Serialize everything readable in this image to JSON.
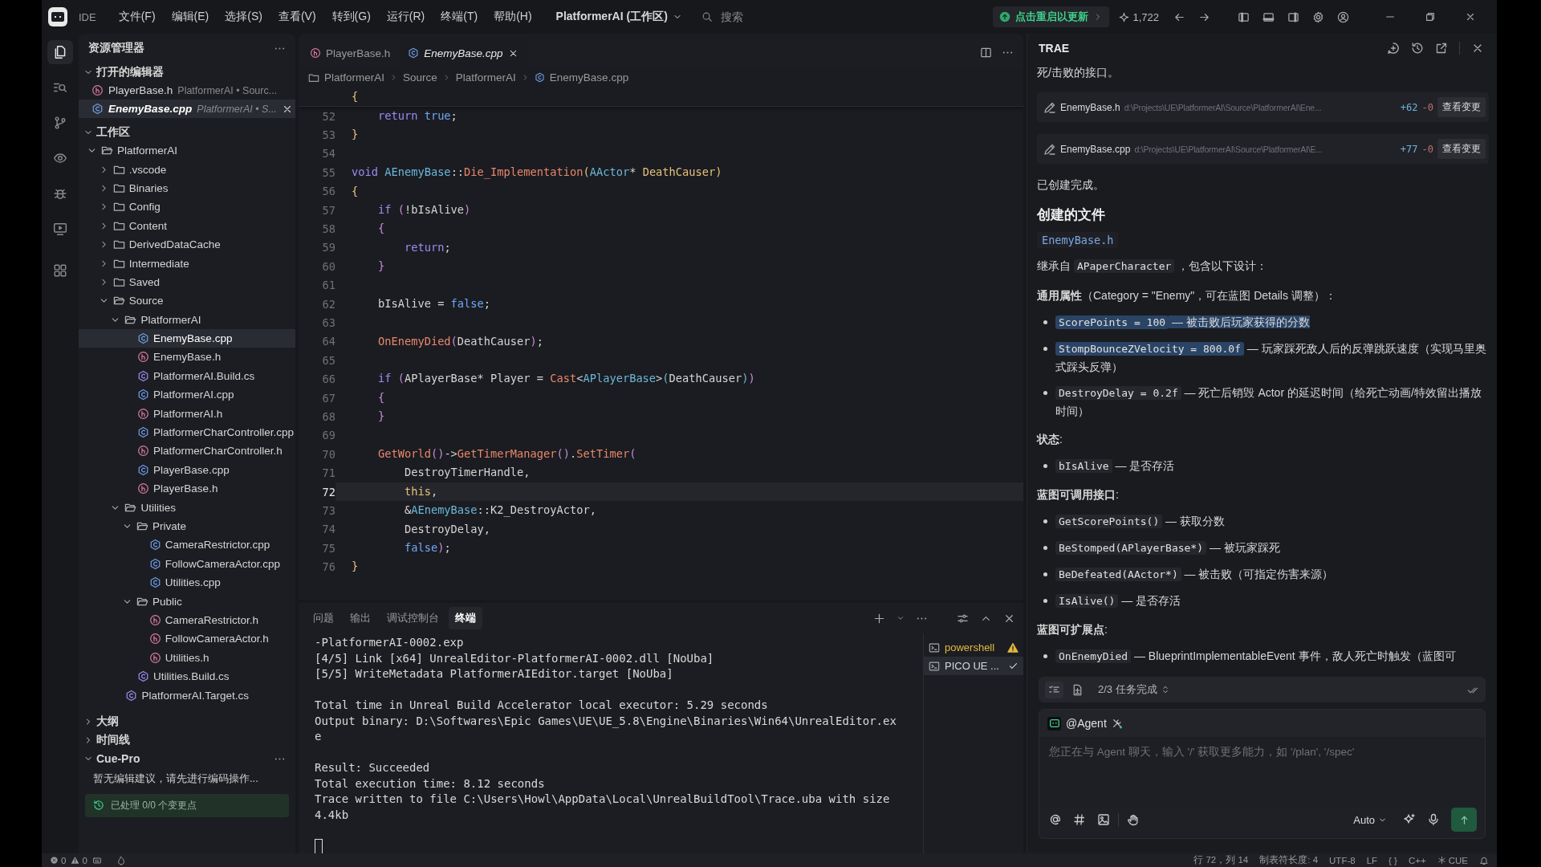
{
  "title_bar": {
    "app_label": "IDE",
    "menus": [
      "文件(F)",
      "编辑(E)",
      "选择(S)",
      "查看(V)",
      "转到(G)",
      "运行(R)",
      "终端(T)",
      "帮助(H)"
    ],
    "workspace": "PlatformerAI (工作区)",
    "search": {
      "placeholder": "搜索"
    },
    "update_button": "点击重启以更新",
    "count": "1,722"
  },
  "activity_bar": {
    "items": [
      {
        "kind": "files",
        "selected": true
      },
      {
        "kind": "search",
        "selected": false
      },
      {
        "kind": "source_control",
        "selected": false
      },
      {
        "kind": "preview",
        "selected": false
      },
      {
        "kind": "debug",
        "selected": false
      },
      {
        "kind": "remote",
        "selected": false
      },
      {
        "kind": "extensions",
        "selected": false
      }
    ]
  },
  "sidebar": {
    "title": "资源管理器",
    "open_editors": {
      "title": "打开的编辑器",
      "expanded": true,
      "items": [
        {
          "name": "PlayerBase.h",
          "kind": "h",
          "description": "PlatformerAI • Sourc...",
          "selected": false
        },
        {
          "name": "EnemyBase.cpp",
          "kind": "cpp",
          "description": "PlatformerAI • S...",
          "selected": true
        }
      ]
    },
    "workspace": {
      "title": "工作区",
      "expanded": true,
      "tree": [
        {
          "name": "PlatformerAI",
          "kind": "folder",
          "expanded": true,
          "selected": false,
          "children": [
            {
              "name": ".vscode",
              "kind": "folder",
              "expanded": false,
              "selected": false
            },
            {
              "name": "Binaries",
              "kind": "folder",
              "expanded": false,
              "selected": false
            },
            {
              "name": "Config",
              "kind": "folder",
              "expanded": false,
              "selected": false
            },
            {
              "name": "Content",
              "kind": "folder",
              "expanded": false,
              "selected": false
            },
            {
              "name": "DerivedDataCache",
              "kind": "folder",
              "expanded": false,
              "selected": false
            },
            {
              "name": "Intermediate",
              "kind": "folder",
              "expanded": false,
              "selected": false
            },
            {
              "name": "Saved",
              "kind": "folder",
              "expanded": false,
              "selected": false
            },
            {
              "name": "Source",
              "kind": "folder",
              "expanded": true,
              "selected": false,
              "children": [
                {
                  "name": "PlatformerAI",
                  "kind": "folder",
                  "expanded": true,
                  "selected": false,
                  "children": [
                    {
                      "name": "EnemyBase.cpp",
                      "kind": "cpp",
                      "selected": true
                    },
                    {
                      "name": "EnemyBase.h",
                      "kind": "h",
                      "selected": false
                    },
                    {
                      "name": "PlatformerAI.Build.cs",
                      "kind": "cs",
                      "selected": false
                    },
                    {
                      "name": "PlatformerAI.cpp",
                      "kind": "cpp",
                      "selected": false
                    },
                    {
                      "name": "PlatformerAI.h",
                      "kind": "h",
                      "selected": false
                    },
                    {
                      "name": "PlatformerCharController.cpp",
                      "kind": "cpp",
                      "selected": false
                    },
                    {
                      "name": "PlatformerCharController.h",
                      "kind": "h",
                      "selected": false
                    },
                    {
                      "name": "PlayerBase.cpp",
                      "kind": "cpp",
                      "selected": false
                    },
                    {
                      "name": "PlayerBase.h",
                      "kind": "h",
                      "selected": false
                    }
                  ]
                },
                {
                  "name": "Utilities",
                  "kind": "folder",
                  "expanded": true,
                  "selected": false,
                  "children": [
                    {
                      "name": "Private",
                      "kind": "folder",
                      "expanded": true,
                      "selected": false,
                      "children": [
                        {
                          "name": "CameraRestrictor.cpp",
                          "kind": "cpp",
                          "selected": false
                        },
                        {
                          "name": "FollowCameraActor.cpp",
                          "kind": "cpp",
                          "selected": false
                        },
                        {
                          "name": "Utilities.cpp",
                          "kind": "cpp",
                          "selected": false
                        }
                      ]
                    },
                    {
                      "name": "Public",
                      "kind": "folder",
                      "expanded": true,
                      "selected": false,
                      "children": [
                        {
                          "name": "CameraRestrictor.h",
                          "kind": "h",
                          "selected": false
                        },
                        {
                          "name": "FollowCameraActor.h",
                          "kind": "h",
                          "selected": false
                        },
                        {
                          "name": "Utilities.h",
                          "kind": "h",
                          "selected": false
                        }
                      ]
                    },
                    {
                      "name": "Utilities.Build.cs",
                      "kind": "cs",
                      "selected": false
                    }
                  ]
                },
                {
                  "name": "PlatformerAI.Target.cs",
                  "kind": "cs",
                  "selected": false
                }
              ]
            }
          ]
        }
      ]
    },
    "sections": [
      {
        "title": "大纲",
        "expanded": false
      },
      {
        "title": "时间线",
        "expanded": false
      }
    ],
    "cue_pro": {
      "title": "Cue-Pro",
      "expanded": true,
      "message": "暂无编辑建议，请先进行编码操作...",
      "status": "已处理 0/0 个变更点"
    }
  },
  "editor": {
    "tabs": [
      {
        "name": "PlayerBase.h",
        "kind": "h",
        "selected": false
      },
      {
        "name": "EnemyBase.cpp",
        "kind": "cpp",
        "selected": true
      }
    ],
    "breadcrumbs": [
      "PlatformerAI",
      "Source",
      "PlatformerAI",
      "EnemyBase.cpp"
    ],
    "sticky_line": [
      {
        "kind": "brace",
        "text": "{"
      }
    ],
    "lines": [
      {
        "number": "52",
        "current": false,
        "tokens": [
          {
            "kind": "keyword",
            "text": "    return"
          },
          {
            "kind": "literal",
            "text": " true"
          },
          {
            "kind": "plain",
            "text": ";"
          }
        ]
      },
      {
        "number": "53",
        "current": false,
        "tokens": [
          {
            "kind": "brace",
            "text": "}"
          }
        ]
      },
      {
        "number": "54",
        "current": false
      },
      {
        "number": "55",
        "current": false,
        "tokens": [
          {
            "kind": "keyword",
            "text": "void"
          },
          {
            "kind": "type",
            "text": " AEnemyBase"
          },
          {
            "kind": "plain",
            "text": "::"
          },
          {
            "kind": "function",
            "text": "Die_Implementation"
          },
          {
            "kind": "brace",
            "text": "("
          },
          {
            "kind": "type",
            "text": "AActor"
          },
          {
            "kind": "plain",
            "text": "* "
          },
          {
            "kind": "param",
            "text": "DeathCauser"
          },
          {
            "kind": "brace",
            "text": ")"
          }
        ]
      },
      {
        "number": "56",
        "current": false,
        "tokens": [
          {
            "kind": "brace",
            "text": "{"
          }
        ]
      },
      {
        "number": "57",
        "current": false,
        "tokens": [
          {
            "kind": "keyword",
            "text": "    if"
          },
          {
            "kind": "paren",
            "text": " ("
          },
          {
            "kind": "plain",
            "text": "!bIsAlive"
          },
          {
            "kind": "paren",
            "text": ")"
          }
        ]
      },
      {
        "number": "58",
        "current": false,
        "tokens": [
          {
            "kind": "paren",
            "text": "    {"
          }
        ]
      },
      {
        "number": "59",
        "current": false,
        "tokens": [
          {
            "kind": "keyword",
            "text": "        return"
          },
          {
            "kind": "plain",
            "text": ";"
          }
        ]
      },
      {
        "number": "60",
        "current": false,
        "tokens": [
          {
            "kind": "paren",
            "text": "    }"
          }
        ]
      },
      {
        "number": "61",
        "current": false
      },
      {
        "number": "62",
        "current": false,
        "tokens": [
          {
            "kind": "plain",
            "text": "    bIsAlive = "
          },
          {
            "kind": "literal",
            "text": "false"
          },
          {
            "kind": "plain",
            "text": ";"
          }
        ]
      },
      {
        "number": "63",
        "current": false
      },
      {
        "number": "64",
        "current": false,
        "tokens": [
          {
            "kind": "function",
            "text": "    OnEnemyDied"
          },
          {
            "kind": "paren",
            "text": "("
          },
          {
            "kind": "plain",
            "text": "DeathCauser"
          },
          {
            "kind": "paren",
            "text": ")"
          },
          {
            "kind": "plain",
            "text": ";"
          }
        ]
      },
      {
        "number": "65",
        "current": false
      },
      {
        "number": "66",
        "current": false,
        "tokens": [
          {
            "kind": "keyword",
            "text": "    if"
          },
          {
            "kind": "paren",
            "text": " ("
          },
          {
            "kind": "plain",
            "text": "APlayerBase* Player = "
          },
          {
            "kind": "function",
            "text": "Cast"
          },
          {
            "kind": "plain",
            "text": "<"
          },
          {
            "kind": "type",
            "text": "APlayerBase"
          },
          {
            "kind": "plain",
            "text": ">"
          },
          {
            "kind": "type",
            "text": "("
          },
          {
            "kind": "plain",
            "text": "DeathCauser"
          },
          {
            "kind": "type",
            "text": ")"
          },
          {
            "kind": "paren",
            "text": ")"
          }
        ]
      },
      {
        "number": "67",
        "current": false,
        "tokens": [
          {
            "kind": "paren",
            "text": "    {"
          }
        ]
      },
      {
        "number": "68",
        "current": false,
        "tokens": [
          {
            "kind": "paren",
            "text": "    }"
          }
        ]
      },
      {
        "number": "69",
        "current": false
      },
      {
        "number": "70",
        "current": false,
        "tokens": [
          {
            "kind": "function",
            "text": "    GetWorld"
          },
          {
            "kind": "paren",
            "text": "()"
          },
          {
            "kind": "plain",
            "text": "->"
          },
          {
            "kind": "function",
            "text": "GetTimerManager"
          },
          {
            "kind": "paren",
            "text": "()"
          },
          {
            "kind": "plain",
            "text": "."
          },
          {
            "kind": "function",
            "text": "SetTimer"
          },
          {
            "kind": "paren",
            "text": "("
          }
        ]
      },
      {
        "number": "71",
        "current": false,
        "tokens": [
          {
            "kind": "plain",
            "text": "        DestroyTimerHandle,"
          }
        ]
      },
      {
        "number": "72",
        "current": true,
        "tokens": [
          {
            "kind": "this",
            "text": "        this"
          },
          {
            "kind": "plain",
            "text": ","
          }
        ]
      },
      {
        "number": "73",
        "current": false,
        "tokens": [
          {
            "kind": "plain",
            "text": "        &"
          },
          {
            "kind": "type",
            "text": "AEnemyBase"
          },
          {
            "kind": "plain",
            "text": "::K2_DestroyActor,"
          }
        ]
      },
      {
        "number": "74",
        "current": false,
        "tokens": [
          {
            "kind": "plain",
            "text": "        DestroyDelay,"
          }
        ]
      },
      {
        "number": "75",
        "current": false,
        "tokens": [
          {
            "kind": "literal",
            "text": "        false"
          },
          {
            "kind": "paren",
            "text": ")"
          },
          {
            "kind": "plain",
            "text": ";"
          }
        ]
      },
      {
        "number": "76",
        "current": false,
        "tokens": [
          {
            "kind": "brace",
            "text": "}"
          }
        ]
      }
    ]
  },
  "panel": {
    "tabs": [
      {
        "label": "问题",
        "selected": false
      },
      {
        "label": "输出",
        "selected": false
      },
      {
        "label": "调试控制台",
        "selected": false
      },
      {
        "label": "终端",
        "selected": true
      }
    ],
    "terminal": {
      "blocks": [
        [
          "-PlatformerAI-0002.exp",
          "[4/5] Link [x64] UnrealEditor-PlatformerAI-0002.dll [NoUba]",
          "[5/5] WriteMetadata PlatformerAIEditor.target [NoUba]"
        ],
        [
          "Total time in Unreal Build Accelerator local executor: 5.29 seconds",
          "Output binary: D:\\Softwares\\Epic Games\\UE\\UE_5.8\\Engine\\Binaries\\Win64\\UnrealEditor.ex",
          "e"
        ],
        [
          "Result: Succeeded",
          "Total execution time: 8.12 seconds",
          "Trace written to file C:\\Users\\Howl\\AppData\\Local\\UnrealBuildTool\\Trace.uba with size",
          "4.4kb"
        ]
      ]
    },
    "sessions": [
      {
        "name": "powershell",
        "kind": "warning",
        "selected": false
      },
      {
        "name": "PICO UE ...",
        "kind": "done",
        "selected": true
      }
    ]
  },
  "chat": {
    "title": "TRAE",
    "blocks": [
      {
        "kind": "text",
        "text": "死/击败的接口。"
      },
      {
        "kind": "file_change",
        "name": "EnemyBase.h",
        "path": "d:\\Projects\\UE\\PlatformerAI\\Source\\PlatformerAI\\Ene...",
        "added": "+62",
        "removed": "-0",
        "action": "查看变更"
      },
      {
        "kind": "file_change",
        "name": "EnemyBase.cpp",
        "path": "d:\\Projects\\UE\\PlatformerAI\\Source\\PlatformerAI\\E...",
        "added": "+77",
        "removed": "-0",
        "action": "查看变更"
      },
      {
        "kind": "text",
        "text": "已创建完成。"
      },
      {
        "kind": "heading",
        "text": "创建的文件"
      },
      {
        "kind": "code",
        "text": "EnemyBase.h"
      },
      {
        "kind": "paragraph",
        "segments": [
          {
            "kind": "text",
            "text": "继承自 ",
            "highlighted": false
          },
          {
            "kind": "code",
            "text": "APaperCharacter",
            "highlighted": false
          },
          {
            "kind": "text",
            "text": " ，包含以下设计：",
            "highlighted": false
          }
        ]
      },
      {
        "kind": "rich",
        "text": "**通用属性**（Category = \"Enemy\"，可在蓝图 Details 调整）："
      },
      {
        "kind": "bullet",
        "segments": [
          {
            "kind": "code",
            "text": "ScorePoints = 100",
            "highlighted": true
          },
          {
            "kind": "text",
            "text": " — 被击败后玩家获得的分数",
            "highlighted": true
          }
        ]
      },
      {
        "kind": "bullet",
        "segments": [
          {
            "kind": "code",
            "text": "StompBounceZVelocity = 800.0f",
            "highlighted": true
          },
          {
            "kind": "text",
            "text": " — 玩家踩死敌人后的反弹跳跃速度（实现马里奥式踩头反弹）",
            "highlighted": false
          }
        ]
      },
      {
        "kind": "bullet",
        "segments": [
          {
            "kind": "code",
            "text": "DestroyDelay = 0.2f",
            "highlighted": false
          },
          {
            "kind": "text",
            "text": " — 死亡后销毁 Actor 的延迟时间（给死亡动画/特效留出播放时间）",
            "highlighted": false
          }
        ]
      },
      {
        "kind": "rich",
        "text": "**状态**:"
      },
      {
        "kind": "bullet",
        "segments": [
          {
            "kind": "code",
            "text": "bIsAlive",
            "highlighted": false
          },
          {
            "kind": "text",
            "text": " — 是否存活",
            "highlighted": false
          }
        ]
      },
      {
        "kind": "rich",
        "text": "**蓝图可调用接口**:"
      },
      {
        "kind": "bullet",
        "segments": [
          {
            "kind": "code",
            "text": "GetScorePoints()",
            "highlighted": false
          },
          {
            "kind": "text",
            "text": " — 获取分数",
            "highlighted": false
          }
        ]
      },
      {
        "kind": "bullet",
        "segments": [
          {
            "kind": "code",
            "text": "BeStomped(APlayerBase*)",
            "highlighted": false
          },
          {
            "kind": "text",
            "text": " — 被玩家踩死",
            "highlighted": false
          }
        ]
      },
      {
        "kind": "bullet",
        "segments": [
          {
            "kind": "code",
            "text": "BeDefeated(AActor*)",
            "highlighted": false
          },
          {
            "kind": "text",
            "text": " — 被击败（可指定伤害来源）",
            "highlighted": false
          }
        ]
      },
      {
        "kind": "bullet",
        "segments": [
          {
            "kind": "code",
            "text": "IsAlive()",
            "highlighted": false
          },
          {
            "kind": "text",
            "text": " — 是否存活",
            "highlighted": false
          }
        ]
      },
      {
        "kind": "rich",
        "text": "**蓝图可扩展点**:"
      },
      {
        "kind": "bullet",
        "segments": [
          {
            "kind": "code",
            "text": "OnEnemyDied",
            "highlighted": false
          },
          {
            "kind": "text",
            "text": " — BlueprintImplementableEvent 事件，敌人死亡时触发（蓝图可",
            "highlighted": false
          }
        ]
      }
    ],
    "tasks": {
      "label": "2/3 任务完成"
    },
    "composer": {
      "agent": "@Agent",
      "placeholder": "您正在与 Agent 聊天，输入 '/' 获取更多能力，如 '/plan', '/spec'",
      "model": "Auto"
    }
  },
  "status_bar": {
    "errors": "0",
    "warnings": "0",
    "position": "行 72，列 14",
    "tab_size": "制表符长度: 4",
    "encoding": "UTF-8",
    "eol": "LF",
    "braces": "{ }",
    "language": "C++",
    "cue": "CUE"
  }
}
